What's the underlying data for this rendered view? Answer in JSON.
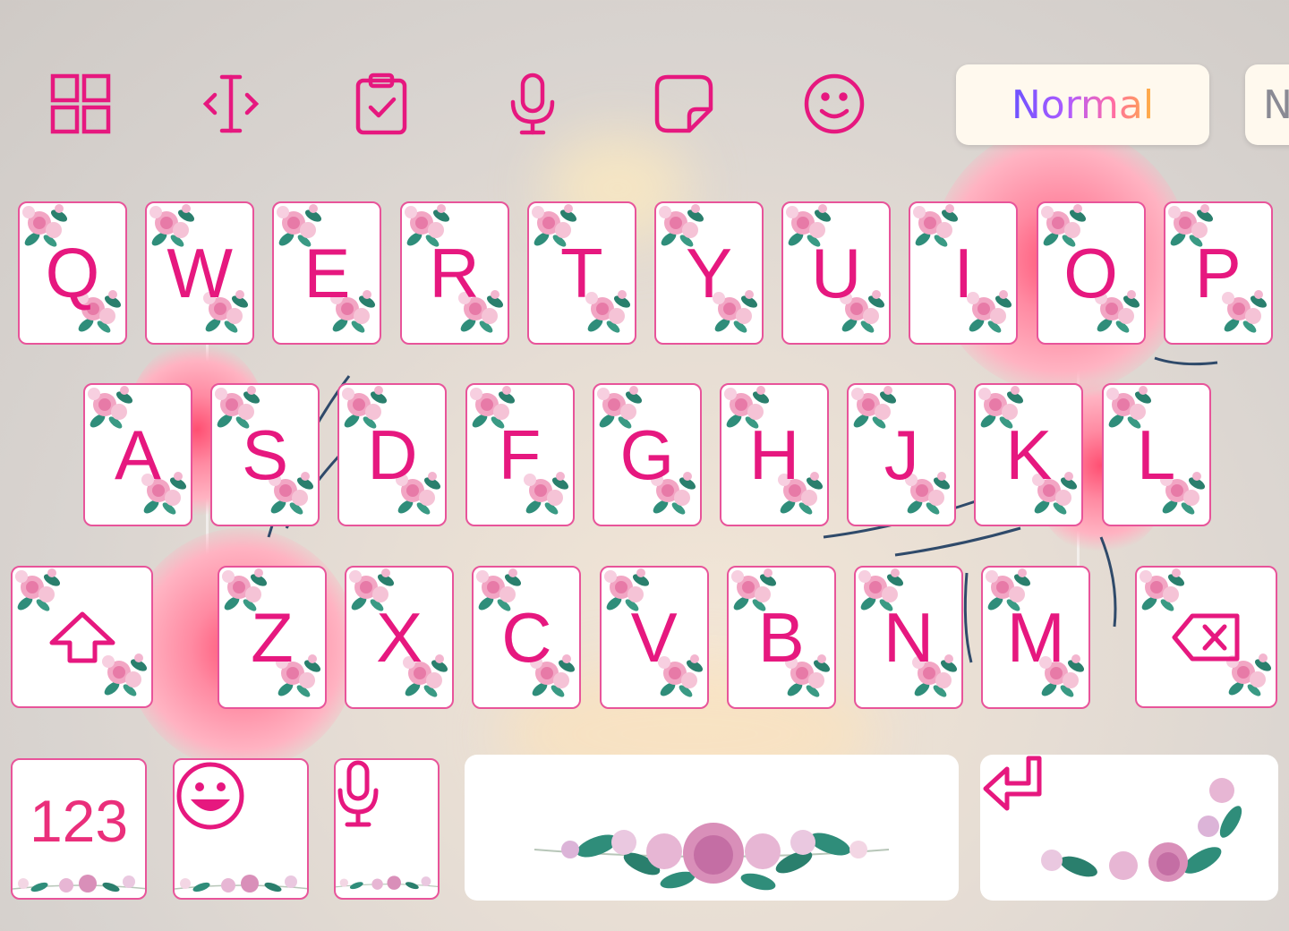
{
  "toolbar": {
    "icons": [
      "grid-icon",
      "text-cursor-icon",
      "clipboard-icon",
      "microphone-icon",
      "sticker-icon",
      "smiley-icon"
    ],
    "chip_active": "Normal",
    "chip_next": "N"
  },
  "keyboard": {
    "row1": [
      "Q",
      "W",
      "E",
      "R",
      "T",
      "Y",
      "U",
      "I",
      "O",
      "P"
    ],
    "row2": [
      "A",
      "S",
      "D",
      "F",
      "G",
      "H",
      "J",
      "K",
      "L"
    ],
    "row3": [
      "Z",
      "X",
      "C",
      "V",
      "B",
      "N",
      "M"
    ],
    "numbers_label": "123"
  },
  "colors": {
    "accent": "#e6187f",
    "key_border": "#e8549a",
    "key_bg": "#ffffff"
  }
}
